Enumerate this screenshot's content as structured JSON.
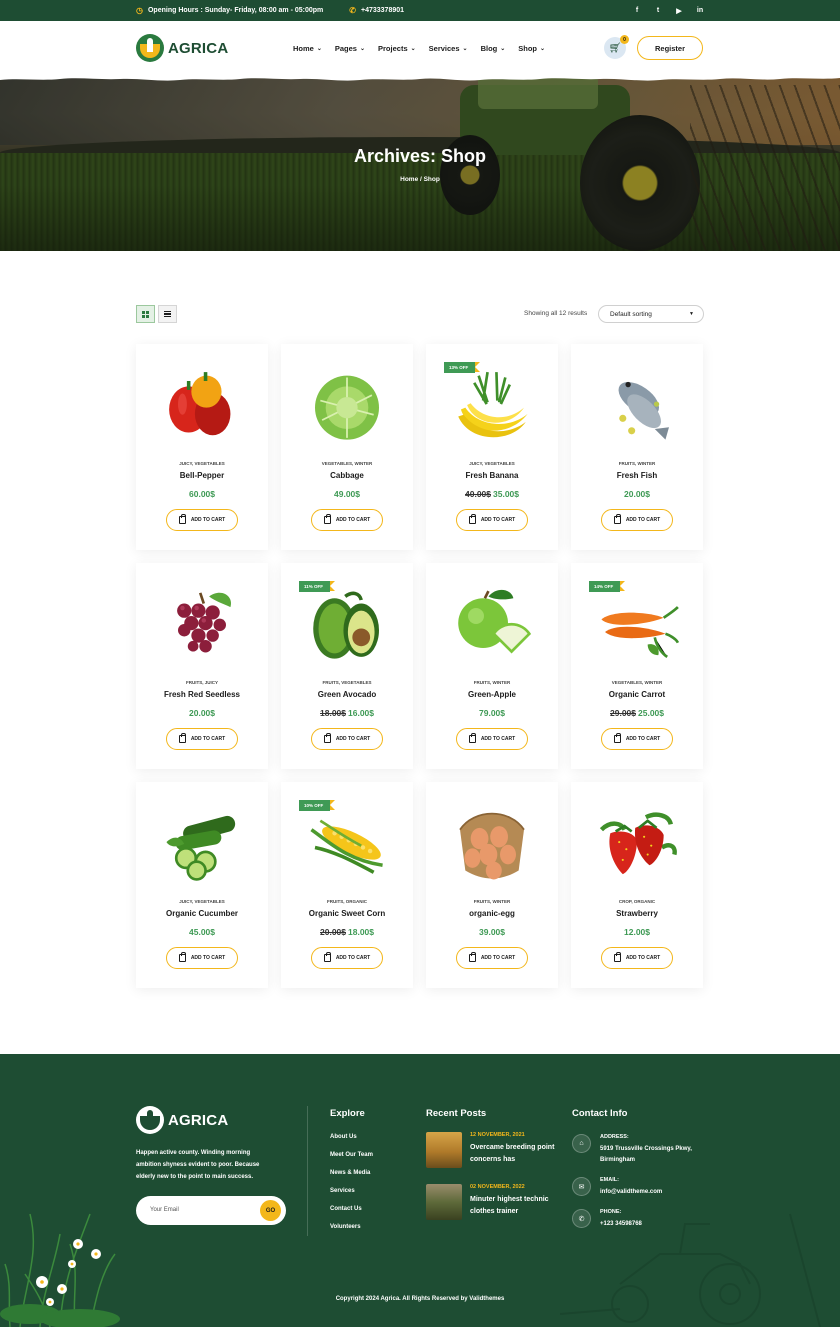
{
  "topbar": {
    "hours": "Opening Hours : Sunday- Friday, 08:00 am - 05:00pm",
    "phone": "+4733378901",
    "social_icons": [
      "facebook-icon",
      "twitter-icon",
      "youtube-icon",
      "linkedin-icon"
    ]
  },
  "header": {
    "logo": "AGRICA",
    "nav": [
      "Home",
      "Pages",
      "Projects",
      "Services",
      "Blog",
      "Shop"
    ],
    "cart_count": "0",
    "register_label": "Register"
  },
  "hero": {
    "title": "Archives: Shop",
    "breadcrumb": "Home / Shop"
  },
  "toolbar": {
    "showing": "Showing all 12 results",
    "sort_selected": "Default sorting"
  },
  "add_to_cart_label": "ADD TO CART",
  "products": [
    {
      "name": "Bell-Pepper",
      "cats": "JUICY, VEGETABLES",
      "price": "60.00$",
      "old_price": "",
      "badge": "",
      "icon": "bell-pepper"
    },
    {
      "name": "Cabbage",
      "cats": "VEGETABLES, WINTER",
      "price": "49.00$",
      "old_price": "",
      "badge": "",
      "icon": "cabbage"
    },
    {
      "name": "Fresh Banana",
      "cats": "JUICY, VEGETABLES",
      "price": "35.00$",
      "old_price": "40.00$",
      "badge": "13% OFF",
      "icon": "banana"
    },
    {
      "name": "Fresh Fish",
      "cats": "FRUITS, WINTER",
      "price": "20.00$",
      "old_price": "",
      "badge": "",
      "icon": "fish"
    },
    {
      "name": "Fresh Red Seedless",
      "cats": "FRUITS, JUICY",
      "price": "20.00$",
      "old_price": "",
      "badge": "",
      "icon": "grapes"
    },
    {
      "name": "Green Avocado",
      "cats": "FRUITS, VEGETABLES",
      "price": "16.00$",
      "old_price": "18.00$",
      "badge": "11% OFF",
      "icon": "avocado"
    },
    {
      "name": "Green-Apple",
      "cats": "FRUITS, WINTER",
      "price": "79.00$",
      "old_price": "",
      "badge": "",
      "icon": "apple"
    },
    {
      "name": "Organic Carrot",
      "cats": "VEGETABLES, WINTER",
      "price": "25.00$",
      "old_price": "29.00$",
      "badge": "14% OFF",
      "icon": "carrot"
    },
    {
      "name": "Organic Cucumber",
      "cats": "JUICY, VEGETABLES",
      "price": "45.00$",
      "old_price": "",
      "badge": "",
      "icon": "cucumber"
    },
    {
      "name": "Organic Sweet Corn",
      "cats": "FRUITS, ORGANIC",
      "price": "18.00$",
      "old_price": "20.00$",
      "badge": "10% OFF",
      "icon": "corn"
    },
    {
      "name": "organic-egg",
      "cats": "FRUITS, WINTER",
      "price": "39.00$",
      "old_price": "",
      "badge": "",
      "icon": "eggs"
    },
    {
      "name": "Strawberry",
      "cats": "CROP, ORGANIC",
      "price": "12.00$",
      "old_price": "",
      "badge": "",
      "icon": "strawberry"
    }
  ],
  "footer": {
    "logo": "AGRICA",
    "about": "Happen active county. Winding morning ambition shyness evident to poor. Because elderly new to the point to main success.",
    "email_placeholder": "Your Email",
    "go_label": "GO",
    "explore_heading": "Explore",
    "explore_links": [
      "About Us",
      "Meet Our Team",
      "News & Media",
      "Services",
      "Contact Us",
      "Volunteers"
    ],
    "posts_heading": "Recent Posts",
    "posts": [
      {
        "date": "12 NOVEMBER, 2021",
        "title": "Overcame breeding point concerns has"
      },
      {
        "date": "02 NOVEMBER, 2022",
        "title": "Minuter highest technic clothes trainer"
      }
    ],
    "contact_heading": "Contact Info",
    "contact": [
      {
        "label": "ADDRESS:",
        "value": "5919 Trussville Crossings Pkwy, Birmingham",
        "icon": "home-icon"
      },
      {
        "label": "EMAIL:",
        "value": "info@validtheme.com",
        "icon": "mail-icon"
      },
      {
        "label": "PHONE:",
        "value": "+123 34598768",
        "icon": "phone-icon"
      }
    ],
    "copyright": "Copyright 2024 Agrica. All Rights Reserved by Validthemes"
  },
  "colors": {
    "brand_green": "#1e4d33",
    "price_green": "#3f9a55",
    "accent_yellow": "#f3b71b"
  }
}
